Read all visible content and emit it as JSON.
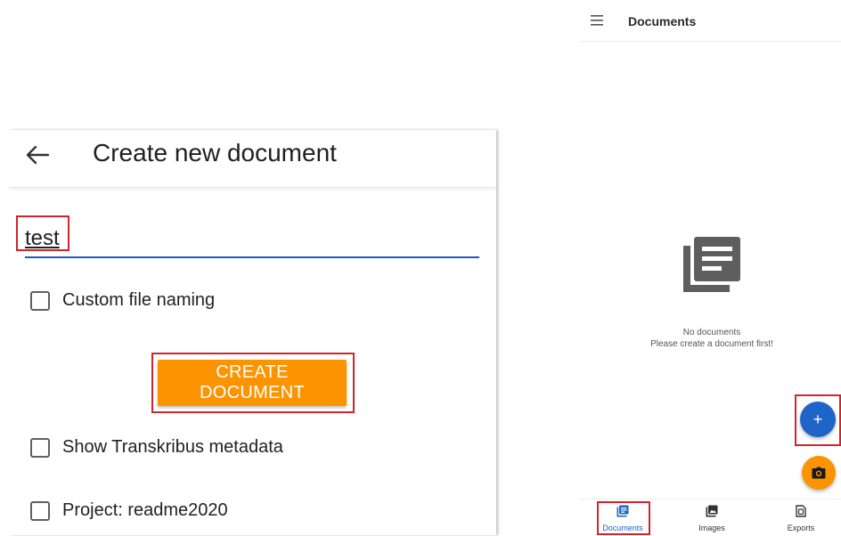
{
  "create_screen": {
    "title": "Create new document",
    "name_value": "test",
    "custom_file_naming_label": "Custom file naming",
    "create_button_label": "CREATE DOCUMENT",
    "show_metadata_label": "Show Transkribus metadata",
    "project_label": "Project: readme2020"
  },
  "documents_screen": {
    "title": "Documents",
    "empty_line1": "No documents",
    "empty_line2": "Please create a document first!",
    "add_fab": "+",
    "nav": {
      "documents": "Documents",
      "images": "Images",
      "exports": "Exports"
    }
  },
  "colors": {
    "accent_blue": "#1f64c7",
    "accent_orange": "#fb9400",
    "highlight_red": "#d0252c"
  }
}
